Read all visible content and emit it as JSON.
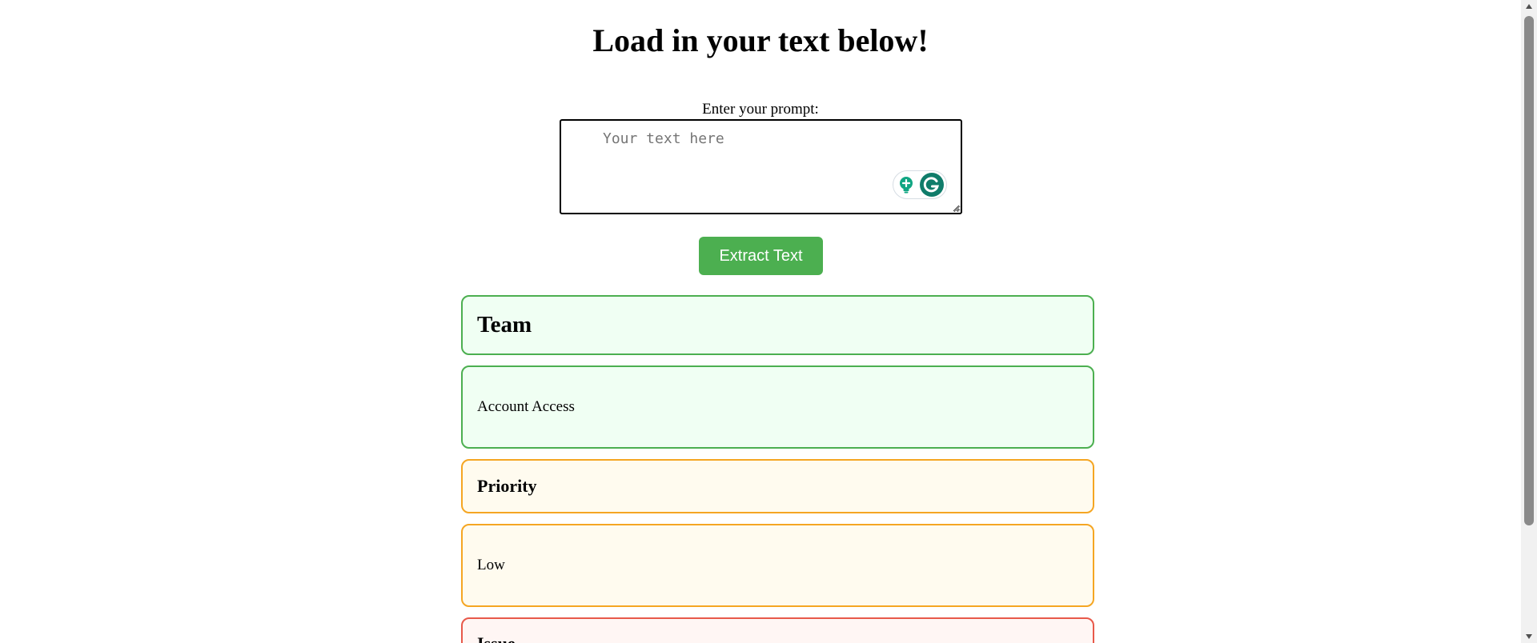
{
  "header": {
    "title": "Load in your text below!"
  },
  "prompt": {
    "label": "Enter your prompt:",
    "value": "",
    "placeholder": "Your text here"
  },
  "extract_button": {
    "label": "Extract Text",
    "color": "#4caf50"
  },
  "results": [
    {
      "kind": "heading",
      "text": "Team",
      "color": "#4caf50"
    },
    {
      "kind": "value",
      "text": "Account Access",
      "color": "#4caf50"
    },
    {
      "kind": "heading",
      "text": "Priority",
      "color": "#f5a623"
    },
    {
      "kind": "value",
      "text": "Low",
      "color": "#f5a623"
    },
    {
      "kind": "heading",
      "text": "Issue",
      "color": "#e8594a"
    }
  ],
  "icons": {
    "assistant_bulb": "lightbulb-icon",
    "assistant_logo": "grammarly-icon"
  },
  "scroll": {
    "position": 0
  }
}
